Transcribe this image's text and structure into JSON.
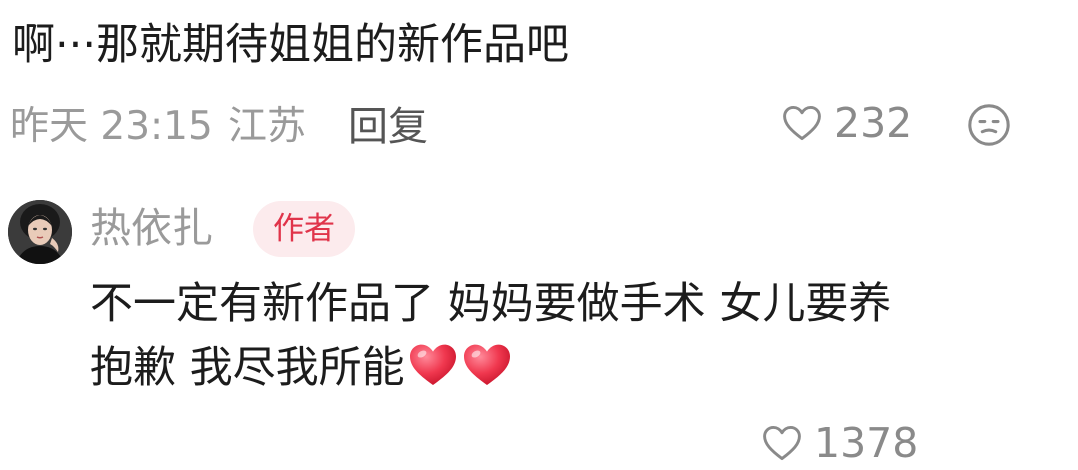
{
  "comment1": {
    "text": "啊···那就期待姐姐的新作品吧",
    "date": "昨天 23:15",
    "location": "江苏",
    "reply_label": "回复",
    "like_count": "232",
    "like_icon": "heart-outline-icon",
    "dislike_icon": "frown-face-icon"
  },
  "reply": {
    "username": "热依扎",
    "badge": "作者",
    "badge_color": "#e0344a",
    "text_line1": "不一定有新作品了 妈妈要做手术 女儿要养",
    "text_line2": "抱歉 我尽我所能",
    "emojis": [
      "red-heart-emoji",
      "red-heart-emoji"
    ],
    "like_count": "1378"
  }
}
